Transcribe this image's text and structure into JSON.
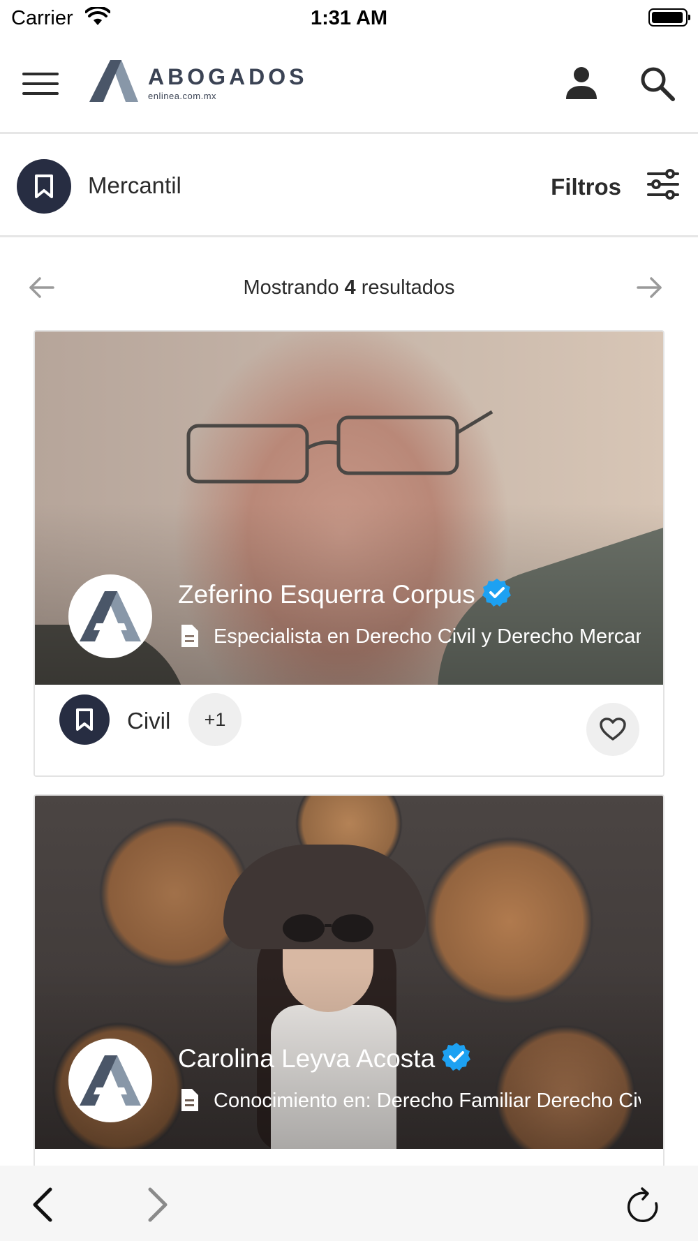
{
  "status_bar": {
    "carrier": "Carrier",
    "time": "1:31 AM"
  },
  "header": {
    "logo_title": "ABOGADOS",
    "logo_subtitle": "enlinea.com.mx",
    "icons": [
      "menu-icon",
      "user-icon",
      "search-icon"
    ]
  },
  "category": {
    "label": "Mercantil",
    "filters_label": "Filtros",
    "icons": [
      "bookmark-icon",
      "sliders-icon"
    ]
  },
  "results": {
    "prefix": "Mostrando",
    "count": "4",
    "suffix": "resultados"
  },
  "cards": [
    {
      "name": "Zeferino Esquerra Corpus",
      "description": "Especialista en Derecho Civil y Derecho Mercantil",
      "tag": "Civil",
      "more_tags": "+1",
      "verified": true
    },
    {
      "name": "Carolina Leyva Acosta",
      "description": "Conocimiento en: Derecho Familiar Derecho Civil",
      "verified": true
    }
  ],
  "colors": {
    "badge_dark": "#272d42",
    "verified_blue": "#1da1f2",
    "logo_dark": "#4a5668",
    "logo_light": "#8897a8",
    "divider": "#e6e6e6"
  },
  "browser_bar": {
    "icons": [
      "back-arrow-icon",
      "forward-arrow-icon",
      "reload-icon"
    ]
  }
}
